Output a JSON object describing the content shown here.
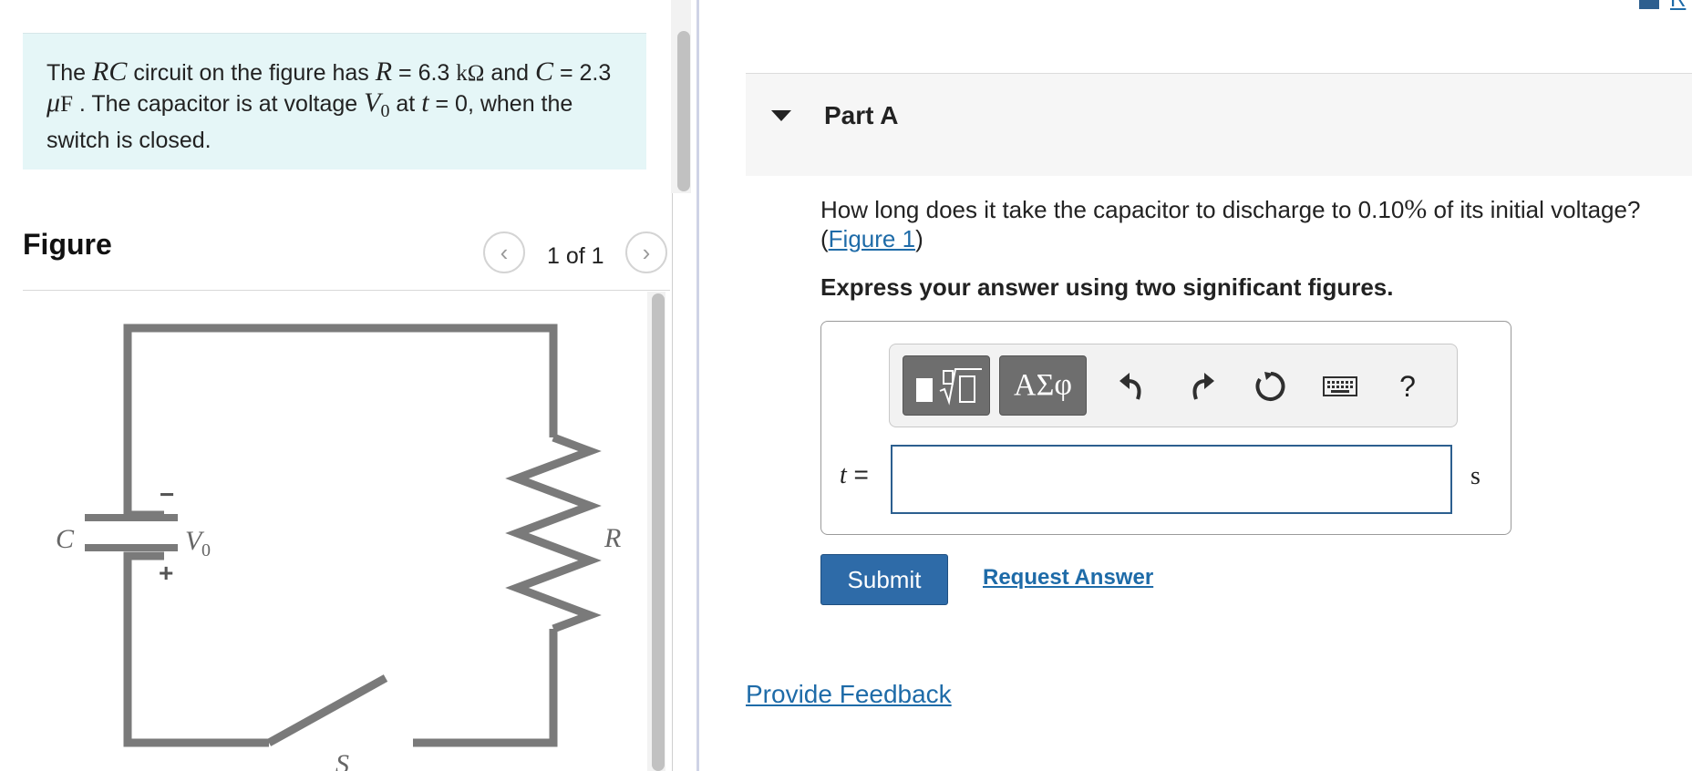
{
  "problem": {
    "t1": "The ",
    "rc": "RC",
    "t2": " circuit on the figure has ",
    "r_sym": "R",
    "eq1": " = 6.3 ",
    "r_unit": "kΩ",
    "t3": " and ",
    "c_sym": "C",
    "eq2": " = 2.3 ",
    "c_unit_mu": "μ",
    "c_unit_f": "F",
    "t4": " . The capacitor is at voltage ",
    "v0_sym": "V",
    "v0_sub": "0",
    "t5": " at ",
    "t_sym": "t",
    "t6": " = 0, when the switch is closed."
  },
  "figure": {
    "title": "Figure",
    "counter": "1 of 1",
    "prev_glyph": "‹",
    "next_glyph": "›",
    "labels": {
      "capacitor": "C",
      "voltage": "V",
      "voltage_sub": "0",
      "minus": "−",
      "plus": "+",
      "resistor": "R",
      "switch": "S"
    }
  },
  "part": {
    "title": "Part A"
  },
  "question": {
    "q1": "How long does it take the capacitor to discharge to 0.10",
    "percent": "%",
    "q2": " of its initial voltage?",
    "paren_open": "(",
    "figure_link": "Figure 1",
    "paren_close": ")"
  },
  "instruction": "Express your answer using two significant figures.",
  "toolbar": {
    "symbols": "ΑΣφ",
    "help": "?"
  },
  "answer": {
    "var": "t",
    "eq": " =",
    "value": "",
    "unit": "s"
  },
  "submit_label": "Submit",
  "request_answer_label": "Request Answer",
  "feedback_label": "Provide Feedback",
  "corner_link": "R"
}
